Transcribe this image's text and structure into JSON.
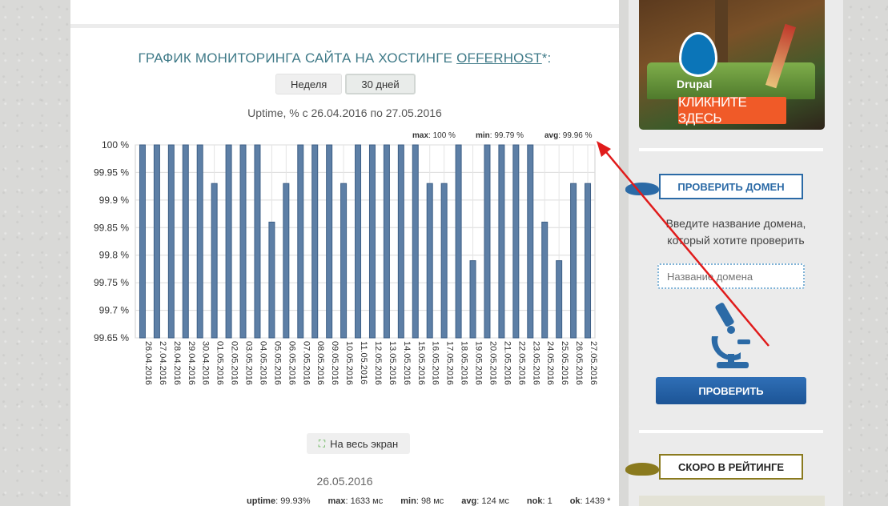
{
  "main": {
    "title_prefix": "ГРАФИК МОНИТОРИНГА САЙТА НА ХОСТИНГЕ",
    "title_link": "OFFERHOST",
    "title_suffix": "*:",
    "tabs": [
      {
        "label": "Неделя",
        "active": false
      },
      {
        "label": "30 дней",
        "active": true
      }
    ],
    "fullscreen_label": "На весь экран",
    "date_label": "26.05.2016",
    "stats": [
      {
        "key": "uptime",
        "value": "99.93%"
      },
      {
        "key": "max",
        "value": "1633 мс"
      },
      {
        "key": "min",
        "value": "98 мс"
      },
      {
        "key": "avg",
        "value": "124 мс"
      },
      {
        "key": "nok",
        "value": "1"
      },
      {
        "key": "ok",
        "value": "1439 *"
      }
    ]
  },
  "chart_data": {
    "type": "bar",
    "title": "Uptime, % с 26.04.2016 по 27.05.2016",
    "summary": {
      "max": "100 %",
      "min": "99.79 %",
      "avg": "99.96 %"
    },
    "ylim": [
      99.65,
      100
    ],
    "yticks": [
      100,
      99.95,
      99.9,
      99.85,
      99.8,
      99.75,
      99.7,
      99.65
    ],
    "ytick_labels": [
      "100 %",
      "99.95 %",
      "99.9 %",
      "99.85 %",
      "99.8 %",
      "99.75 %",
      "99.7 %",
      "99.65 %"
    ],
    "categories": [
      "26.04.2016",
      "27.04.2016",
      "28.04.2016",
      "29.04.2016",
      "30.04.2016",
      "01.05.2016",
      "02.05.2016",
      "03.05.2016",
      "04.05.2016",
      "05.05.2016",
      "06.05.2016",
      "07.05.2016",
      "08.05.2016",
      "09.05.2016",
      "10.05.2016",
      "11.05.2016",
      "12.05.2016",
      "13.05.2016",
      "14.05.2016",
      "15.05.2016",
      "16.05.2016",
      "17.05.2016",
      "18.05.2016",
      "19.05.2016",
      "20.05.2016",
      "21.05.2016",
      "22.05.2016",
      "23.05.2016",
      "24.05.2016",
      "25.05.2016",
      "26.05.2016",
      "27.05.2016"
    ],
    "values": [
      100,
      100,
      100,
      100,
      100,
      99.93,
      100,
      100,
      100,
      99.86,
      99.93,
      100,
      100,
      100,
      99.93,
      100,
      100,
      100,
      100,
      100,
      99.93,
      99.93,
      100,
      99.79,
      100,
      100,
      100,
      100,
      99.86,
      99.79,
      99.93,
      99.93
    ],
    "bar_color": "#5d7fa6",
    "grid": true
  },
  "sidebar": {
    "banner_brand": "Drupal",
    "banner_cta": "КЛИКНИТЕ ЗДЕСЬ",
    "check_domain_title": "ПРОВЕРИТЬ ДОМЕН",
    "check_text_1": "Введите название домена,",
    "check_text_2": "который хотите проверить",
    "domain_placeholder": "Название домена",
    "check_button": "ПРОВЕРИТЬ",
    "soon_title": "СКОРО В РЕЙТИНГЕ"
  },
  "colors": {
    "title": "#3f7a88",
    "blue_ribbon": "#2b6aa6",
    "olive_ribbon": "#8a7a1e",
    "arrow": "#e01b1b",
    "cta": "#f05a28"
  }
}
